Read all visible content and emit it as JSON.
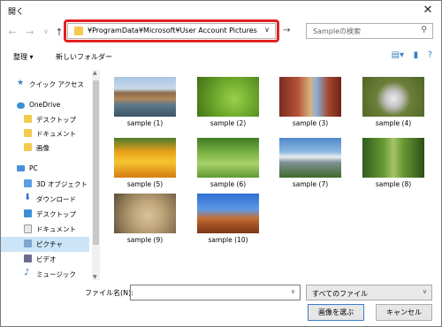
{
  "window": {
    "title": "開く"
  },
  "address": {
    "path": "¥ProgramData¥Microsoft¥User Account Pictures"
  },
  "search": {
    "placeholder": "Sampleの検索"
  },
  "toolbar": {
    "organize": "整理 ▾",
    "new_folder": "新しいフォルダー"
  },
  "nav": {
    "quick_access": "クイック アクセス",
    "onedrive": "OneDrive",
    "od_desktop": "デスクトップ",
    "od_documents": "ドキュメント",
    "od_pictures": "画像",
    "pc": "PC",
    "objects3d": "3D オブジェクト",
    "downloads": "ダウンロード",
    "desktop": "デスクトップ",
    "documents": "ドキュメント",
    "pictures": "ピクチャ",
    "videos": "ビデオ",
    "music": "ミュージック"
  },
  "files": [
    "sample (1)",
    "sample (2)",
    "sample (3)",
    "sample (4)",
    "sample (5)",
    "sample (6)",
    "sample (7)",
    "sample (8)",
    "sample (9)",
    "sample (10)"
  ],
  "bottom": {
    "filename_label": "ファイル名(N):",
    "filename_value": "",
    "filetype": "すべてのファイル",
    "open_button": "画像を選ぶ",
    "cancel_button": "キャンセル"
  },
  "colors": {
    "accent": "#3b7dc9",
    "highlight_outline": "#e32020",
    "selected_nav": "#cce4f7"
  }
}
